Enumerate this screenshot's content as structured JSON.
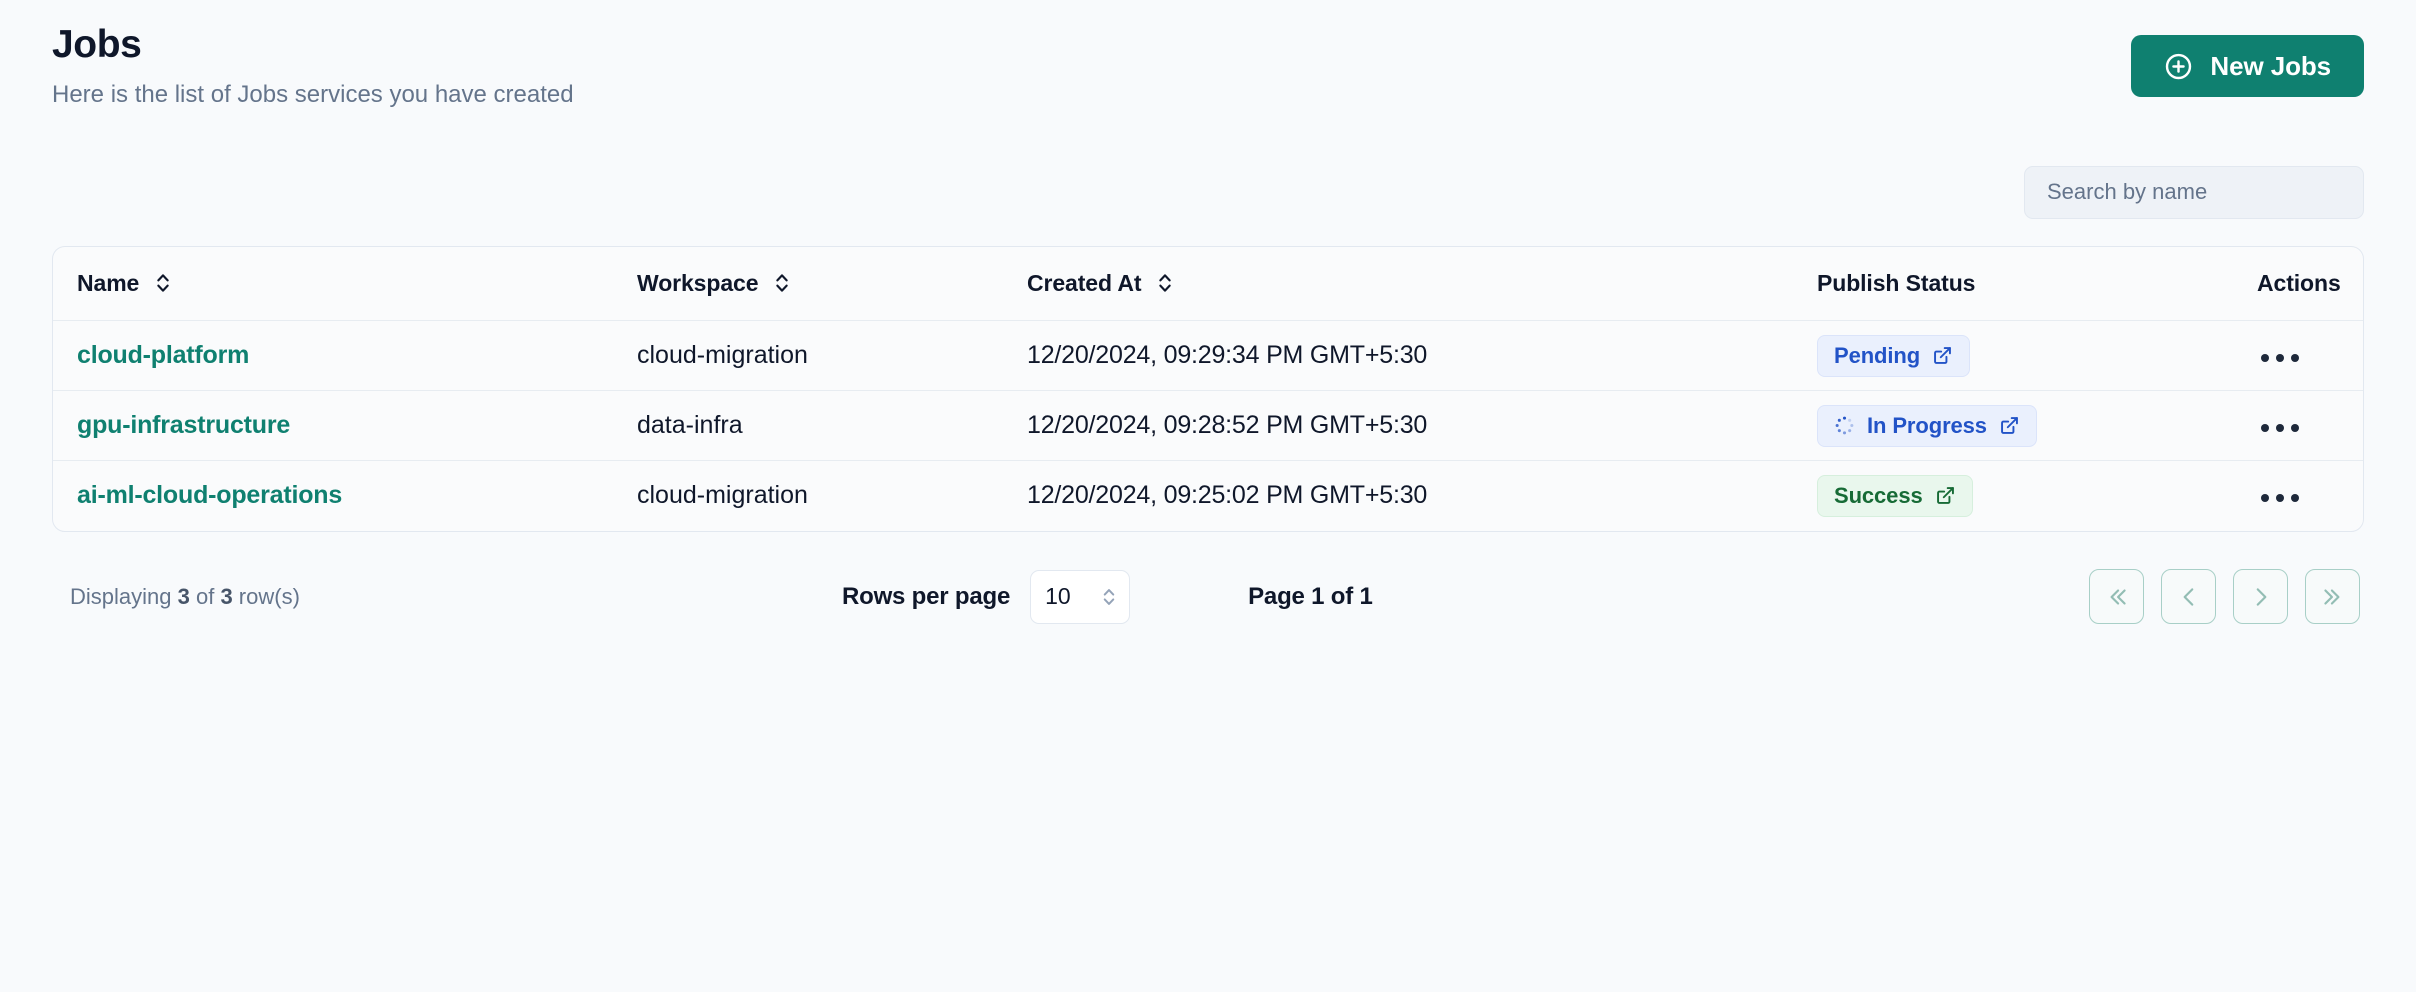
{
  "header": {
    "title": "Jobs",
    "subtitle": "Here is the list of Jobs services you have created",
    "new_button_label": "New Jobs",
    "new_button_icon": "plus-circle-icon",
    "accent_color": "#0f8070"
  },
  "search": {
    "placeholder": "Search by name",
    "value": ""
  },
  "table": {
    "columns": [
      {
        "label": "Name",
        "sortable": true
      },
      {
        "label": "Workspace",
        "sortable": true
      },
      {
        "label": "Created At",
        "sortable": true
      },
      {
        "label": "Publish Status",
        "sortable": false
      },
      {
        "label": "Actions",
        "sortable": false
      }
    ],
    "rows": [
      {
        "name": "cloud-platform",
        "workspace": "cloud-migration",
        "created_at": "12/20/2024, 09:29:34 PM GMT+5:30",
        "status": "Pending",
        "status_kind": "pending",
        "status_icon": "external-link-icon",
        "actions_icon": "ellipsis-icon"
      },
      {
        "name": "gpu-infrastructure",
        "workspace": "data-infra",
        "created_at": "12/20/2024, 09:28:52 PM GMT+5:30",
        "status": "In Progress",
        "status_kind": "inprogress",
        "status_icon": "external-link-icon",
        "leading_icon": "spinner-icon",
        "actions_icon": "ellipsis-icon"
      },
      {
        "name": "ai-ml-cloud-operations",
        "workspace": "cloud-migration",
        "created_at": "12/20/2024, 09:25:02 PM GMT+5:30",
        "status": "Success",
        "status_kind": "success",
        "status_icon": "external-link-icon",
        "actions_icon": "ellipsis-icon"
      }
    ]
  },
  "footer": {
    "displaying_prefix": "Displaying ",
    "displaying_count": "3",
    "displaying_middle": " of ",
    "displaying_total": "3",
    "displaying_suffix": " row(s)",
    "rows_per_page_label": "Rows per page",
    "rows_per_page_value": "10",
    "page_indicator": "Page 1 of 1",
    "pager": [
      {
        "name": "first-page",
        "glyph": "chevrons-left-icon"
      },
      {
        "name": "previous-page",
        "glyph": "chevron-left-icon"
      },
      {
        "name": "next-page",
        "glyph": "chevron-right-icon"
      },
      {
        "name": "last-page",
        "glyph": "chevrons-right-icon"
      }
    ]
  },
  "colors": {
    "background": "#f8fafc",
    "accent_teal": "#0f8070",
    "status_blue_text": "#2253c7",
    "status_blue_bg": "#eaf0fd",
    "status_green_text": "#176b36",
    "status_green_bg": "#e9f7ed"
  }
}
